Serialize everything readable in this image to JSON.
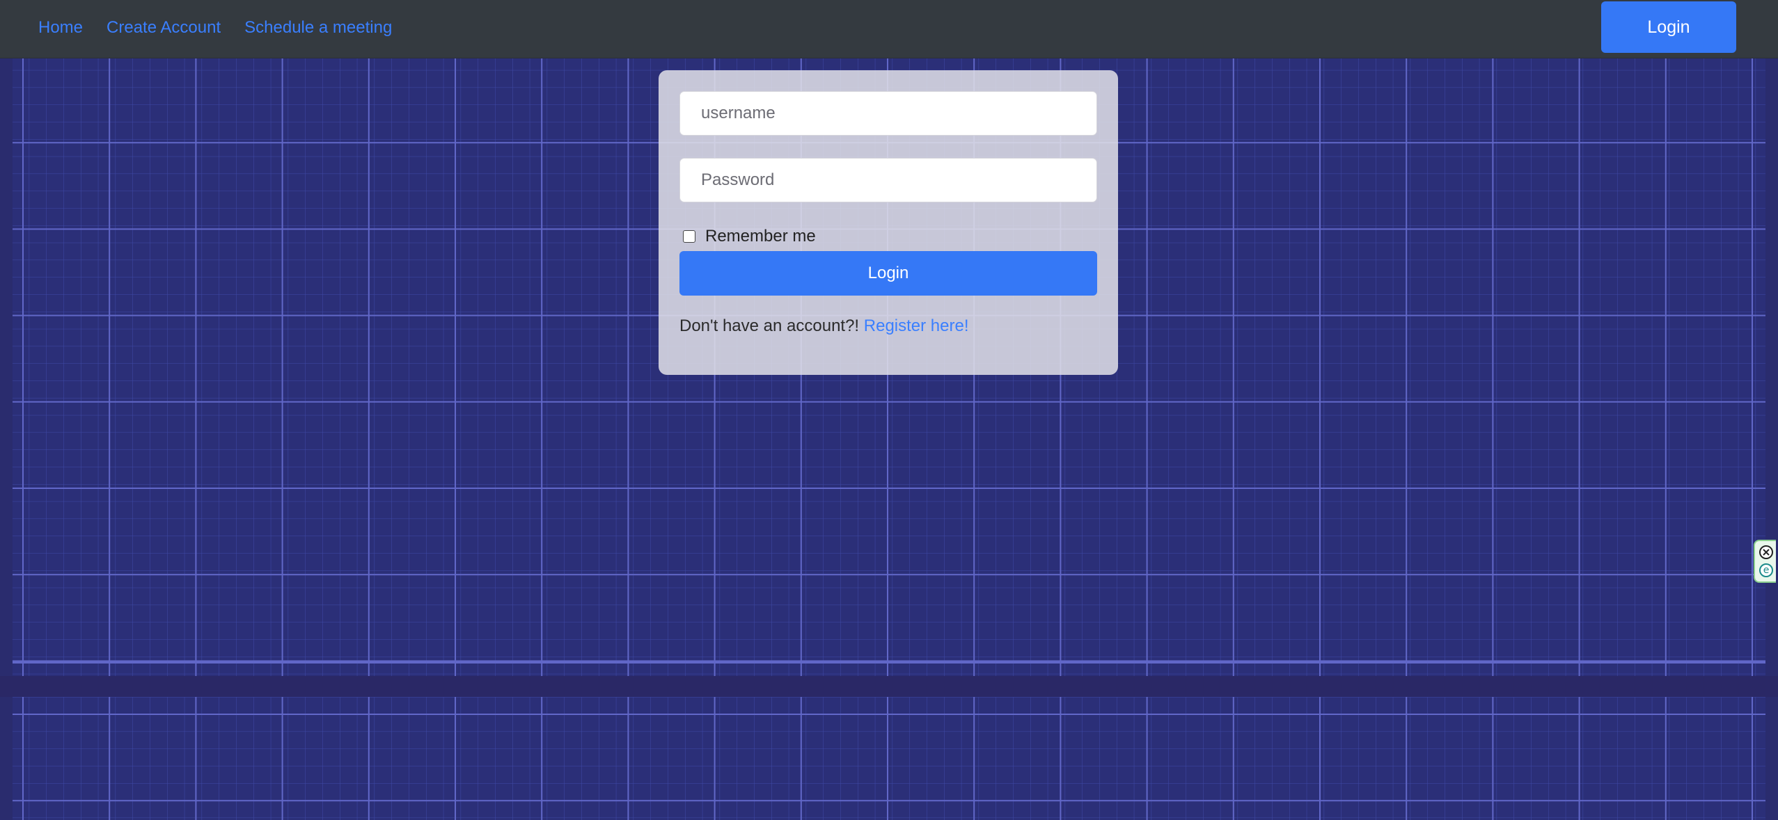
{
  "navbar": {
    "links": [
      {
        "label": "Home"
      },
      {
        "label": "Create Account"
      },
      {
        "label": "Schedule a meeting"
      }
    ],
    "login_button": "Login"
  },
  "login_form": {
    "username_placeholder": "username",
    "password_placeholder": "Password",
    "remember_label": "Remember me",
    "remember_checked": false,
    "submit_label": "Login",
    "register_prompt": "Don't have an account?!",
    "register_link": "Register here!"
  },
  "side_widget": {
    "icons": [
      "close-icon",
      "e-icon"
    ],
    "e_glyph": "e"
  },
  "theme": {
    "navbar_bg": "#343a40",
    "accent": "#3578f6",
    "link": "#3a7fff",
    "background": "#2a2c6e",
    "grid_line": "#5a5fc0"
  }
}
